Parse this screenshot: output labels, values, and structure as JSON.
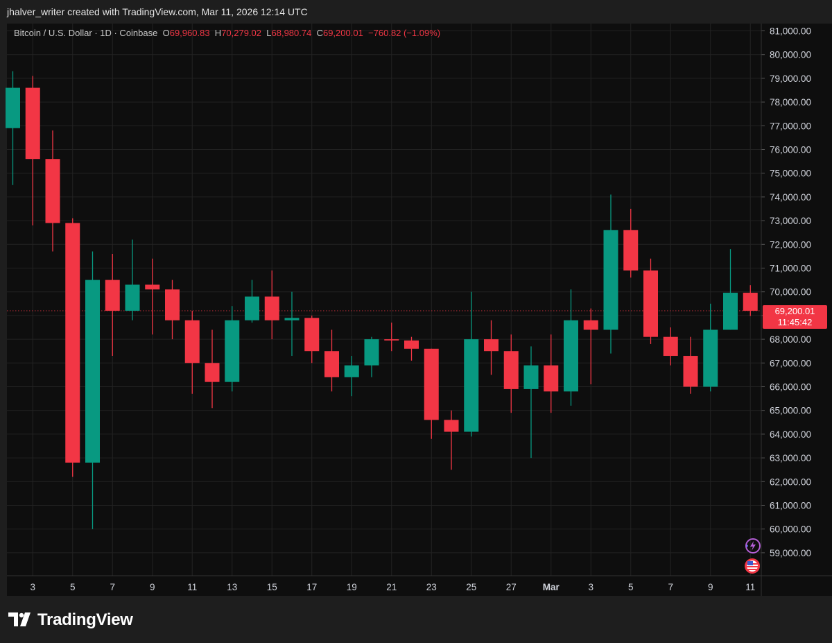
{
  "header": {
    "attribution": "jhalver_writer created with TradingView.com, Mar 11, 2026 12:14 UTC"
  },
  "legend": {
    "symbol": "Bitcoin / U.S. Dollar · 1D · Coinbase",
    "o_label": "O",
    "o_value": "69,960.83",
    "h_label": "H",
    "h_value": "70,279.02",
    "l_label": "L",
    "l_value": "68,980.74",
    "c_label": "C",
    "c_value": "69,200.01",
    "change": "−760.82 (−1.09%)"
  },
  "price_tag": {
    "price": "69,200.01",
    "countdown": "11:45:42"
  },
  "brand": {
    "name": "TradingView"
  },
  "colors": {
    "up": "#089981",
    "down": "#f23645",
    "background": "#0e0e0e",
    "grid": "#222222",
    "text": "#d1d4dc"
  },
  "icons": [
    "sparkle-lightning-icon",
    "us-flag-icon",
    "tradingview-logo-icon"
  ],
  "chart_data": {
    "type": "candlestick",
    "title": "Bitcoin / U.S. Dollar · 1D · Coinbase",
    "y_tick_labels": [
      "81,000.00",
      "80,000.00",
      "79,000.00",
      "78,000.00",
      "77,000.00",
      "76,000.00",
      "75,000.00",
      "74,000.00",
      "73,000.00",
      "72,000.00",
      "71,000.00",
      "70,000.00",
      "69,000.00",
      "68,000.00",
      "67,000.00",
      "66,000.00",
      "65,000.00",
      "64,000.00",
      "63,000.00",
      "62,000.00",
      "61,000.00",
      "60,000.00",
      "59,000.00"
    ],
    "x_tick_labels": [
      "3",
      "5",
      "7",
      "9",
      "11",
      "13",
      "15",
      "17",
      "19",
      "21",
      "23",
      "25",
      "27",
      "Mar",
      "3",
      "5",
      "7",
      "9",
      "11"
    ],
    "ylim": [
      58000,
      81500
    ],
    "grid": true,
    "last_price": 69200.01,
    "candles": [
      {
        "date": "Feb 2",
        "open": 76900,
        "high": 79300,
        "low": 74500,
        "close": 78600
      },
      {
        "date": "Feb 3",
        "open": 78600,
        "high": 79100,
        "low": 72800,
        "close": 75600
      },
      {
        "date": "Feb 4",
        "open": 75600,
        "high": 76800,
        "low": 71700,
        "close": 72900
      },
      {
        "date": "Feb 5",
        "open": 72900,
        "high": 73100,
        "low": 62200,
        "close": 62800
      },
      {
        "date": "Feb 6",
        "open": 62800,
        "high": 71700,
        "low": 60000,
        "close": 70500
      },
      {
        "date": "Feb 7",
        "open": 70500,
        "high": 71600,
        "low": 67300,
        "close": 69200
      },
      {
        "date": "Feb 8",
        "open": 69200,
        "high": 72200,
        "low": 68800,
        "close": 70300
      },
      {
        "date": "Feb 9",
        "open": 70300,
        "high": 71400,
        "low": 68200,
        "close": 70100
      },
      {
        "date": "Feb 10",
        "open": 70100,
        "high": 70500,
        "low": 68000,
        "close": 68800
      },
      {
        "date": "Feb 11",
        "open": 68800,
        "high": 69200,
        "low": 65700,
        "close": 67000
      },
      {
        "date": "Feb 12",
        "open": 67000,
        "high": 68400,
        "low": 65100,
        "close": 66200
      },
      {
        "date": "Feb 13",
        "open": 66200,
        "high": 69400,
        "low": 65800,
        "close": 68800
      },
      {
        "date": "Feb 14",
        "open": 68800,
        "high": 70500,
        "low": 68700,
        "close": 69800
      },
      {
        "date": "Feb 15",
        "open": 69800,
        "high": 70900,
        "low": 68000,
        "close": 68800
      },
      {
        "date": "Feb 16",
        "open": 68800,
        "high": 70000,
        "low": 67300,
        "close": 68900
      },
      {
        "date": "Feb 17",
        "open": 68900,
        "high": 69000,
        "low": 67000,
        "close": 67500
      },
      {
        "date": "Feb 18",
        "open": 67500,
        "high": 68400,
        "low": 65800,
        "close": 66400
      },
      {
        "date": "Feb 19",
        "open": 66400,
        "high": 67300,
        "low": 65600,
        "close": 66900
      },
      {
        "date": "Feb 20",
        "open": 66900,
        "high": 68100,
        "low": 66400,
        "close": 68000
      },
      {
        "date": "Feb 21",
        "open": 68000,
        "high": 68700,
        "low": 67500,
        "close": 67950
      },
      {
        "date": "Feb 22",
        "open": 67950,
        "high": 68100,
        "low": 67100,
        "close": 67600
      },
      {
        "date": "Feb 23",
        "open": 67600,
        "high": 67600,
        "low": 63800,
        "close": 64600
      },
      {
        "date": "Feb 24",
        "open": 64600,
        "high": 65000,
        "low": 62500,
        "close": 64100
      },
      {
        "date": "Feb 25",
        "open": 64100,
        "high": 70000,
        "low": 63900,
        "close": 68000
      },
      {
        "date": "Feb 26",
        "open": 68000,
        "high": 68800,
        "low": 66500,
        "close": 67500
      },
      {
        "date": "Feb 27",
        "open": 67500,
        "high": 68200,
        "low": 64900,
        "close": 65900
      },
      {
        "date": "Feb 28",
        "open": 65900,
        "high": 67700,
        "low": 63000,
        "close": 66900
      },
      {
        "date": "Mar 1",
        "open": 66900,
        "high": 68200,
        "low": 64900,
        "close": 65800
      },
      {
        "date": "Mar 2",
        "open": 65800,
        "high": 70100,
        "low": 65200,
        "close": 68800
      },
      {
        "date": "Mar 3",
        "open": 68800,
        "high": 69300,
        "low": 66100,
        "close": 68400
      },
      {
        "date": "Mar 4",
        "open": 68400,
        "high": 74100,
        "low": 67400,
        "close": 72600
      },
      {
        "date": "Mar 5",
        "open": 72600,
        "high": 73500,
        "low": 70600,
        "close": 70900
      },
      {
        "date": "Mar 6",
        "open": 70900,
        "high": 71400,
        "low": 67800,
        "close": 68100
      },
      {
        "date": "Mar 7",
        "open": 68100,
        "high": 68500,
        "low": 66900,
        "close": 67300
      },
      {
        "date": "Mar 8",
        "open": 67300,
        "high": 68100,
        "low": 65700,
        "close": 66000
      },
      {
        "date": "Mar 9",
        "open": 66000,
        "high": 69500,
        "low": 65800,
        "close": 68400
      },
      {
        "date": "Mar 10",
        "open": 68400,
        "high": 71800,
        "low": 68400,
        "close": 69960.83
      },
      {
        "date": "Mar 11",
        "open": 69960.83,
        "high": 70279.02,
        "low": 68980.74,
        "close": 69200.01
      }
    ]
  }
}
